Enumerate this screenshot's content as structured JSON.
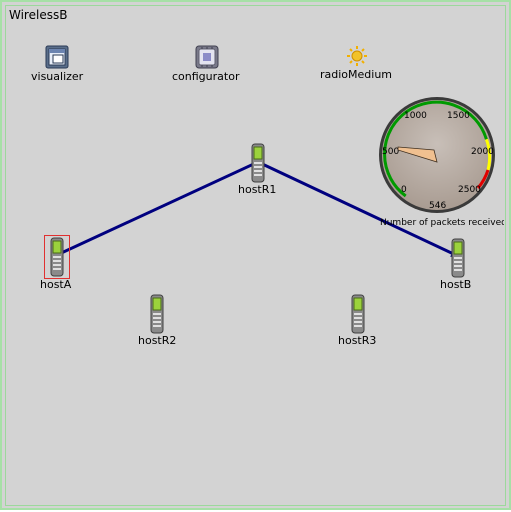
{
  "network": {
    "title": "WirelessB",
    "background": "#d3d3d3",
    "border_color": "#a6e0a6"
  },
  "modules": {
    "visualizer": {
      "label": "visualizer",
      "icon": "visualizer-window-icon"
    },
    "configurator": {
      "label": "configurator",
      "icon": "configurator-chip-icon"
    },
    "radioMedium": {
      "label": "radioMedium",
      "icon": "sun-radio-icon"
    }
  },
  "hosts": {
    "hostA": {
      "label": "hostA",
      "icon": "mobile-phone-icon",
      "selected": true
    },
    "hostR1": {
      "label": "hostR1",
      "icon": "mobile-phone-icon"
    },
    "hostR2": {
      "label": "hostR2",
      "icon": "mobile-phone-icon"
    },
    "hostR3": {
      "label": "hostR3",
      "icon": "mobile-phone-icon"
    },
    "hostB": {
      "label": "hostB",
      "icon": "mobile-phone-icon"
    }
  },
  "route": {
    "path": [
      "hostA",
      "hostR1",
      "hostB"
    ],
    "color": "#00007f"
  },
  "gauge": {
    "title": "Number of packets received",
    "value": 546,
    "value_label": "546",
    "min": 0,
    "max": 2500,
    "ticks": [
      "0",
      "500",
      "1000",
      "1500",
      "2000",
      "2500"
    ],
    "ring_colors": {
      "low": "#00a000",
      "mid": "#ffff00",
      "high": "#ff0000"
    },
    "face_color": "#b9aea6",
    "needle_color": "#f0c090"
  }
}
